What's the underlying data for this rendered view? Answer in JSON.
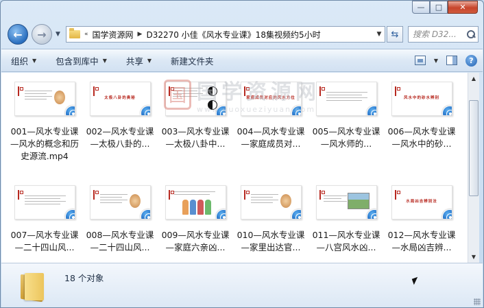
{
  "window": {
    "caption_minimize": "—",
    "caption_maximize": "□",
    "caption_close": "✕"
  },
  "address": {
    "crumbs": [
      "国学资源网",
      "D32270 小佳《风水专业课》18集视频约5小时"
    ],
    "overflow": "«"
  },
  "search": {
    "placeholder": "搜索 D32..."
  },
  "commands": {
    "organize": "组织",
    "include": "包含到库中",
    "share": "共享",
    "new_folder": "新建文件夹"
  },
  "files": [
    {
      "label": "001—风水专业课—风水的概念和历史源流.mp4",
      "thumb_title": "",
      "kind": "text-pic"
    },
    {
      "label": "002—风水专业课—太极八卦的...",
      "thumb_title": "太极八卦的奥秘",
      "kind": "title"
    },
    {
      "label": "003—风水专业课—太极八卦中...",
      "thumb_title": "",
      "kind": "yinyang"
    },
    {
      "label": "004—风水专业课—家庭成员对...",
      "thumb_title": "家庭成员对应的风水方位",
      "kind": "title"
    },
    {
      "label": "005—风水专业课—风水师的...",
      "thumb_title": "",
      "kind": "text"
    },
    {
      "label": "006—风水专业课—风水中的砂...",
      "thumb_title": "风水中的砂水辨别",
      "kind": "title"
    },
    {
      "label": "007—风水专业课—二十四山风...",
      "thumb_title": "",
      "kind": "text"
    },
    {
      "label": "008—风水专业课—二十四山风...",
      "thumb_title": "",
      "kind": "text-pic"
    },
    {
      "label": "009—风水专业课—家庭六亲凶...",
      "thumb_title": "",
      "kind": "people"
    },
    {
      "label": "010—风水专业课—家里出达官...",
      "thumb_title": "",
      "kind": "text-pic"
    },
    {
      "label": "011—风水专业课—八宫风水凶...",
      "thumb_title": "",
      "kind": "house"
    },
    {
      "label": "012—风水专业课—水局凶吉辨...",
      "thumb_title": "水局凶吉辨别法",
      "kind": "title"
    }
  ],
  "watermark": {
    "seal": "国",
    "title": "国学资源网",
    "url": "www.guoxueziyuan.com"
  },
  "details": {
    "count": "18 个对象"
  },
  "colors": {
    "accent": "#b7281f",
    "media_badge": "#0d55b3"
  }
}
